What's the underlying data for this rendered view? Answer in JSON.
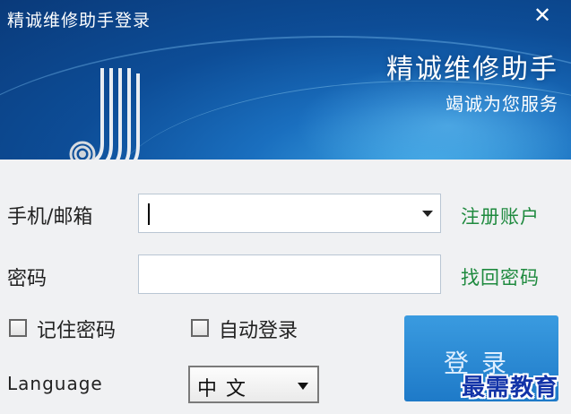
{
  "window": {
    "title": "精诚维修助手登录",
    "close_icon": "close-icon"
  },
  "banner": {
    "brand_title": "精诚维修助手",
    "brand_subtitle": "竭诚为您服务",
    "logo": "company-logo"
  },
  "form": {
    "account_label": "手机/邮箱",
    "account_value": "",
    "password_label": "密码",
    "password_value": "",
    "register_link": "注册账户",
    "recover_link": "找回密码",
    "remember_label": "记住密码",
    "remember_checked": false,
    "autologin_label": "自动登录",
    "autologin_checked": false,
    "language_label": "Language",
    "language_value": "中文",
    "login_button": "登录"
  },
  "watermark": "最需教育",
  "colors": {
    "banner": "#0d4d97",
    "link": "#1f8a3f",
    "login_button": "#2a8ad4",
    "watermark": "#1233a8"
  }
}
